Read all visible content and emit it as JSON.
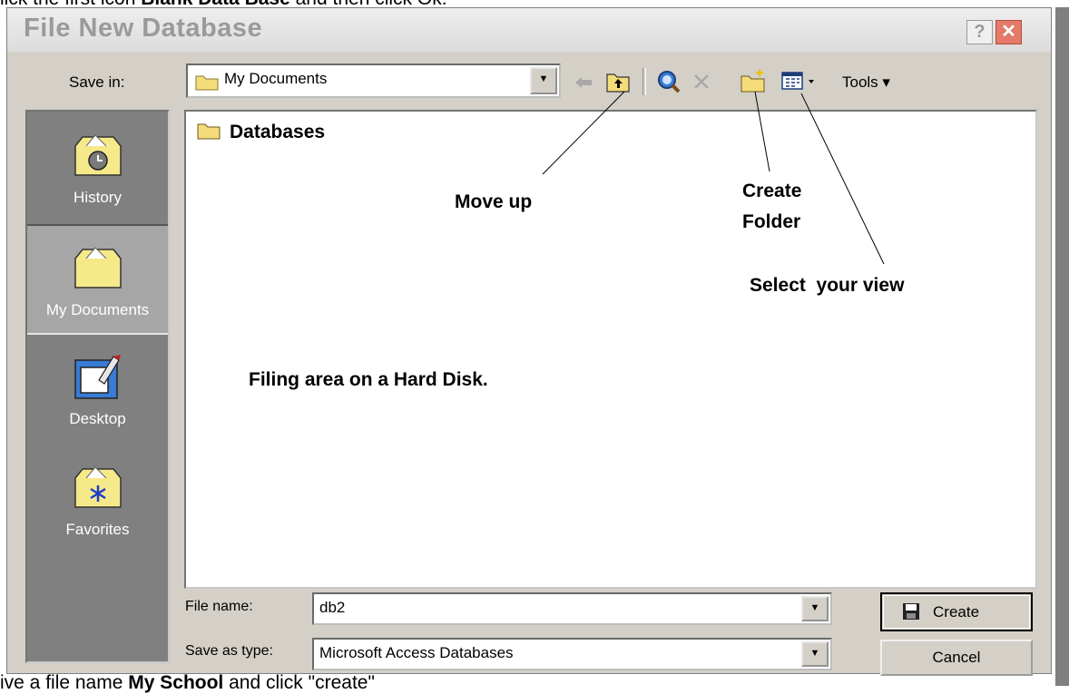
{
  "document": {
    "top_text_plain_1": "lick the first icon ",
    "top_text_bold": "Blank Data Base",
    "top_text_plain_2": " and then click Ok.",
    "bottom_text_plain_1": "ive a file name ",
    "bottom_text_bold": "My School",
    "bottom_text_plain_2": " and click \"create\""
  },
  "dialog": {
    "title": "File New Database",
    "help_label": "?",
    "close_label": "✕",
    "save_in_label": "Save in:",
    "save_in_value": "My Documents",
    "tools_label": "Tools ▾",
    "places": [
      {
        "label": "History",
        "icon": "history-icon"
      },
      {
        "label": "My Documents",
        "icon": "my-documents-icon"
      },
      {
        "label": "Desktop",
        "icon": "desktop-icon"
      },
      {
        "label": "Favorites",
        "icon": "favorites-icon"
      }
    ],
    "files": [
      {
        "name": "Databases",
        "icon": "folder-icon"
      }
    ],
    "file_name_label": "File name:",
    "file_name_value": "db2",
    "save_as_type_label": "Save as type:",
    "save_as_type_value": "Microsoft Access Databases",
    "create_label": "Create",
    "cancel_label": "Cancel"
  },
  "annotations": {
    "move_up": "Move up",
    "create_folder_line1": "Create",
    "create_folder_line2": "Folder",
    "select_view": "Select  your view",
    "filing_area": "Filing area on a Hard Disk."
  },
  "colors": {
    "dialog_bg": "#d4d0c8",
    "places_bg": "#808080",
    "close_button": "#e37a6a",
    "title_text": "#9a9a9a"
  }
}
